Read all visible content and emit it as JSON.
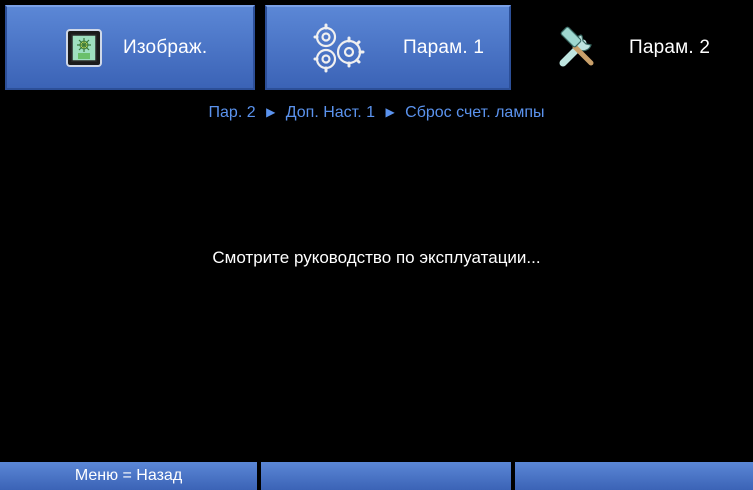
{
  "tabs": [
    {
      "label": "Изображ.",
      "icon": "image-settings-icon",
      "active": false
    },
    {
      "label": "Парам. 1",
      "icon": "gears-icon",
      "active": false
    },
    {
      "label": "Парам. 2",
      "icon": "tools-icon",
      "active": true
    }
  ],
  "breadcrumb": {
    "items": [
      "Пар. 2",
      "Доп. Наст. 1",
      "Сброс счет. лампы"
    ],
    "separator": "▶"
  },
  "message": "Смотрите руководство по эксплуатации...",
  "footer": {
    "hint": "Меню = Назад",
    "cell2": "",
    "cell3": ""
  },
  "colors": {
    "tab_blue": "#4a76c8",
    "breadcrumb_blue": "#5b93ee",
    "background": "#000000"
  }
}
